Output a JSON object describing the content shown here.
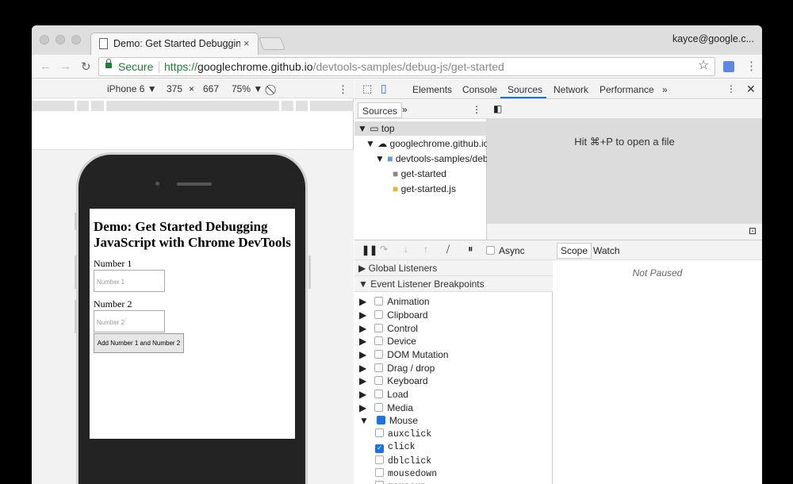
{
  "tab": {
    "title": "Demo: Get Started Debugging",
    "close": "×"
  },
  "user": "kayce@google.c...",
  "address": {
    "secure": "Secure",
    "scheme": "https://",
    "host": "googlechrome.github.io",
    "path": "/devtools-samples/debug-js/get-started"
  },
  "device_toolbar": {
    "device": "iPhone 6 ▼",
    "width": "375",
    "times": "×",
    "height": "667",
    "zoom": "75% ▼"
  },
  "page": {
    "heading": "Demo: Get Started Debugging JavaScript with Chrome DevTools",
    "label1": "Number 1",
    "placeholder1": "Number 1",
    "label2": "Number 2",
    "placeholder2": "Number 2",
    "button": "Add Number 1 and Number 2"
  },
  "devtools": {
    "tabs": [
      "Elements",
      "Console",
      "Sources",
      "Network",
      "Performance",
      "»"
    ],
    "active_tab": "Sources",
    "navigator_tab": "Sources",
    "navigator_more": "»",
    "tree": [
      "top",
      "googlechrome.github.io",
      "devtools-samples/debu",
      "get-started",
      "get-started.js"
    ],
    "editor_hint": "Hit ⌘+P to open a file",
    "async": "Async",
    "sections": {
      "global": "Global Listeners",
      "event": "Event Listener Breakpoints"
    },
    "breakpoints": [
      "Animation",
      "Clipboard",
      "Control",
      "Device",
      "DOM Mutation",
      "Drag / drop",
      "Keyboard",
      "Load",
      "Media",
      "Mouse"
    ],
    "mouse_events": [
      "auxclick",
      "click",
      "dblclick",
      "mousedown",
      "mouseup"
    ],
    "scope_tabs": [
      "Scope",
      "Watch"
    ],
    "not_paused": "Not Paused"
  },
  "colors": {
    "accent": "#1a73e8",
    "secure": "#188038"
  }
}
